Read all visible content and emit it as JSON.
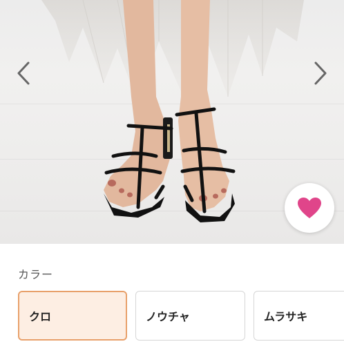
{
  "product_image": {
    "alt": "",
    "prev_icon": "chevron-left-icon",
    "next_icon": "chevron-right-icon"
  },
  "favorite": {
    "icon": "heart-icon",
    "color": "#e0458a"
  },
  "color_section": {
    "label": "カラー",
    "options": [
      {
        "label": "クロ",
        "selected": true
      },
      {
        "label": "ノウチャ",
        "selected": false
      },
      {
        "label": "ムラサキ",
        "selected": false
      }
    ]
  },
  "colors": {
    "selected_bg": "#fdeee3",
    "selected_border": "#e8a06a",
    "border": "#d6d6d6"
  }
}
